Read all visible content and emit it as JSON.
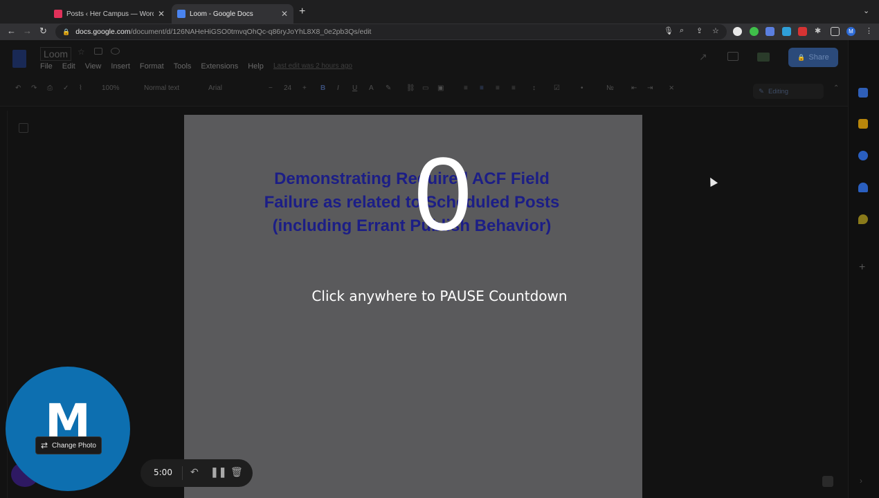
{
  "browser": {
    "tabs": [
      {
        "title": "Posts ‹ Her Campus — WordPress",
        "active": false,
        "favicon_color": "#e0315a"
      },
      {
        "title": "Loom - Google Docs",
        "active": true,
        "favicon_color": "#4a84f0"
      }
    ],
    "new_tab_label": "+",
    "url": {
      "host": "docs.google.com",
      "path": "/document/d/126NAHeHiGSO0tmvqOhQc-q86ryJoYhL8X8_0e2pb3Qs/edit"
    }
  },
  "docs": {
    "title": "Loom",
    "menu": [
      "File",
      "Edit",
      "View",
      "Insert",
      "Format",
      "Tools",
      "Extensions",
      "Help"
    ],
    "last_edit": "Last edit was 2 hours ago",
    "share_label": "Share",
    "account_initial": "M",
    "toolbar": {
      "zoom": "100%",
      "style": "Normal text",
      "font": "Arial",
      "font_size": "24"
    },
    "editing_mode": "Editing",
    "heading_lines": [
      "Demonstrating Required ACF Field",
      "Failure as related to Scheduled Posts",
      "(including Errant Publish Behavior)"
    ]
  },
  "loom": {
    "countdown": "0",
    "hint": "Click anywhere to PAUSE Countdown",
    "avatar_letter": "M",
    "change_photo_label": "Change Photo",
    "timer": "5:00",
    "bubble_color": "#0d6fb0"
  }
}
